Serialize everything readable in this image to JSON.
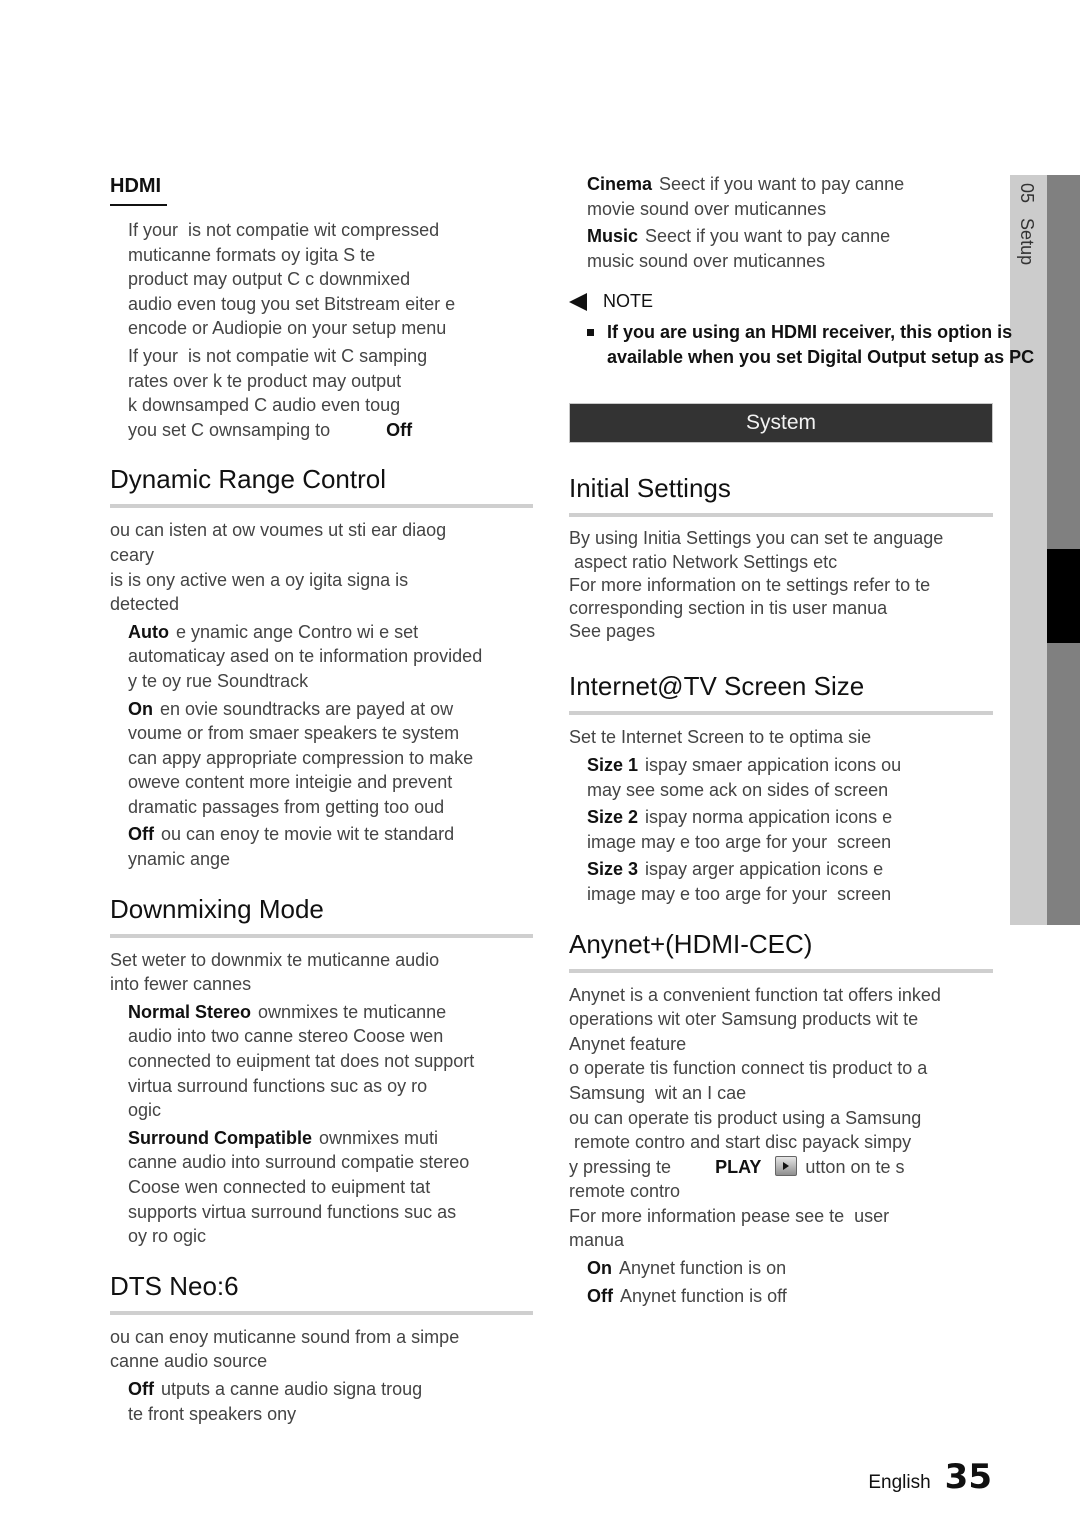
{
  "side_tab": {
    "chapter": "05",
    "label": "Setup"
  },
  "left_column": {
    "hdmi": {
      "title": "HDMI",
      "paragraphs": [
        "If your  is not compatie wit compressed\nmuticanne formats oy igita S te\nproduct may output C c downmixed\naudio even toug you set Bitstream eiter e\nencode or Audiopie on your setup menu",
        "If your  is not compatie wit C samping\nrates over k te product may output\nk downsamped C audio even toug"
      ],
      "last_line_prefix": "you set C ownsamping to",
      "last_line_value": "Off"
    },
    "dynamic_range": {
      "title": "Dynamic Range Control",
      "intro": "ou can isten at ow voumes ut sti ear diaog\nceary\nis is ony active wen a oy igita signa is\ndetected",
      "options": [
        {
          "label": "Auto",
          "text": "e ynamic ange Contro wi e set\nautomaticay ased on te information provided\ny te oy rue Soundtrack"
        },
        {
          "label": "On",
          "text": "en ovie soundtracks are payed at ow\nvoume or from smaer speakers te system\ncan appy appropriate compression to make\noweve content more inteigie and prevent\ndramatic passages from getting too oud"
        },
        {
          "label": "Off",
          "text": "ou can enoy te movie wit te standard\nynamic ange"
        }
      ]
    },
    "downmixing": {
      "title": "Downmixing Mode",
      "intro": "Set weter to downmix te muticanne audio\ninto fewer cannes",
      "options": [
        {
          "label": "Normal Stereo",
          "text": "ownmixes te muticanne\naudio into two canne stereo Coose wen\nconnected to euipment tat does not support\nvirtua surround functions suc as oy ro\nogic"
        },
        {
          "label": "Surround Compatible",
          "text": "ownmixes muti\ncanne audio into surround compatie stereo\nCoose wen connected to euipment tat\nsupports virtua surround functions suc as\noy ro ogic"
        }
      ]
    },
    "dts_neo": {
      "title": "DTS Neo:6",
      "intro": "ou can enoy muticanne sound from a simpe\ncanne audio source",
      "options": [
        {
          "label": "Off",
          "text": "utputs a canne audio signa troug\nte front speakers ony"
        }
      ]
    }
  },
  "right_column": {
    "continued_options": [
      {
        "label": "Cinema",
        "text": "Seect if you want to pay canne\nmovie sound over muticannes"
      },
      {
        "label": "Music",
        "text": "Seect if you want to pay canne\nmusic sound over muticannes"
      }
    ],
    "note": {
      "heading": "NOTE",
      "lines": [
        "If you are using an HDMI receiver, this option is",
        "available when you set Digital Output setup as PC"
      ]
    },
    "system_bar": "System",
    "initial_settings": {
      "title": "Initial Settings",
      "body": "By using Initia Settings you can set te anguage\n aspect ratio Network Settings etc\nFor more information on te settings refer to te\ncorresponding section in tis user manua\nSee pages"
    },
    "screen_size": {
      "title": "Internet@TV Screen Size",
      "intro": "Set te Internet Screen to te optima sie",
      "options": [
        {
          "label": "Size 1",
          "text": "ispay smaer appication icons ou\nmay see some ack on sides of screen"
        },
        {
          "label": "Size 2",
          "text": "ispay norma appication icons e\nimage may e too arge for your  screen"
        },
        {
          "label": "Size 3",
          "text": "ispay arger appication icons e\nimage may e too arge for your  screen"
        }
      ]
    },
    "anynet": {
      "title": "Anynet+(HDMI-CEC)",
      "body_1": "Anynet is a convenient function tat offers inked\noperations wit oter Samsung products wit te\nAnynet feature\no operate tis function connect tis product to a\nSamsung  wit an I cae\nou can operate tis product using a Samsung\n remote contro and start disc payack simpy",
      "play_prefix": "y pressing te",
      "play_word": "PLAY",
      "play_icon": "play-button-icon",
      "play_suffix": "utton on te s",
      "body_2": "remote contro\nFor more information pease see te  user\nmanua",
      "options": [
        {
          "label": "On",
          "text": "Anynet function is on"
        },
        {
          "label": "Off",
          "text": "Anynet function is off"
        }
      ]
    }
  },
  "footer": {
    "language": "English",
    "page_number": "35"
  }
}
